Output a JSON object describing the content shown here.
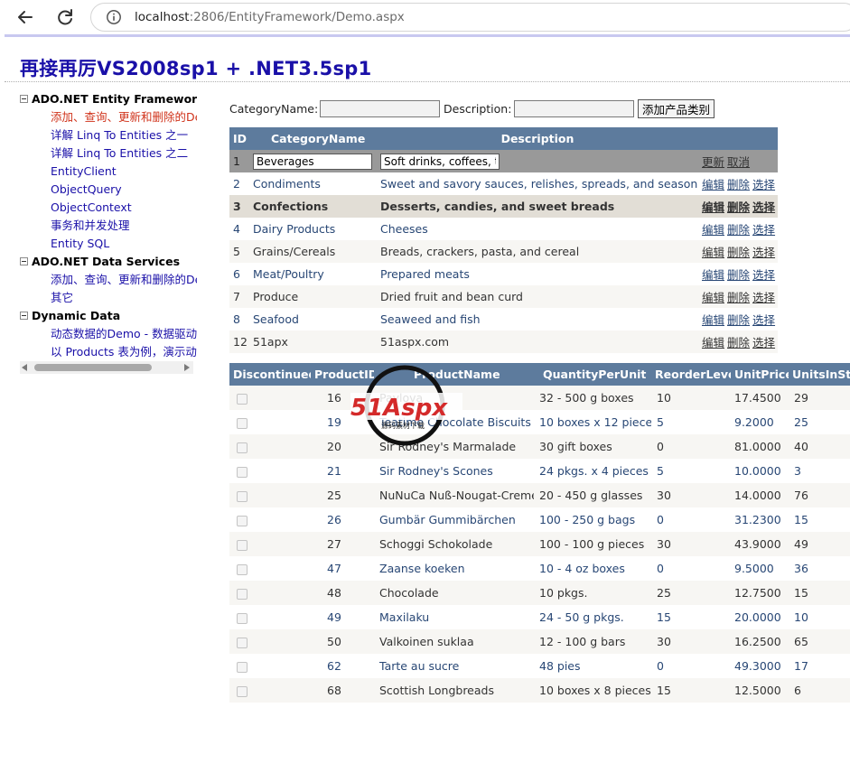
{
  "browser": {
    "url_host": "localhost",
    "url_rest": ":2806/EntityFramework/Demo.aspx"
  },
  "page": {
    "title": "再接再厉VS2008sp1 + .NET3.5sp1"
  },
  "tree": {
    "groups": [
      {
        "label": "ADO.NET Entity Framework",
        "items": [
          "添加、查询、更新和删除的De",
          "详解 Linq To Entities 之一",
          "详解 Linq To Entities 之二",
          "EntityClient",
          "ObjectQuery",
          "ObjectContext",
          "事务和并发处理",
          "Entity SQL"
        ]
      },
      {
        "label": "ADO.NET Data Services",
        "items": [
          "添加、查询、更新和删除的De",
          "其它"
        ]
      },
      {
        "label": "Dynamic Data",
        "items": [
          "动态数据的Demo - 数据驱动的",
          "以 Products 表为例，演示动态"
        ]
      }
    ]
  },
  "form": {
    "category_label": "CategoryName:",
    "category_value": "",
    "description_label": "Description:",
    "description_value": "",
    "add_button": "添加产品类别"
  },
  "categories": {
    "headers": [
      "ID",
      "CategoryName",
      "Description"
    ],
    "edit_row": {
      "id": "1",
      "name": "Beverages",
      "description": "Soft drinks, coffees, tea",
      "update": "更新",
      "cancel": "取消"
    },
    "action_labels": {
      "edit": "编辑",
      "delete": "删除",
      "select": "选择"
    },
    "rows": [
      {
        "id": "2",
        "name": "Condiments",
        "description": "Sweet and savory sauces, relishes, spreads, and seasonings"
      },
      {
        "id": "3",
        "name": "Confections",
        "description": "Desserts, candies, and sweet breads"
      },
      {
        "id": "4",
        "name": "Dairy Products",
        "description": "Cheeses"
      },
      {
        "id": "5",
        "name": "Grains/Cereals",
        "description": "Breads, crackers, pasta, and cereal"
      },
      {
        "id": "6",
        "name": "Meat/Poultry",
        "description": "Prepared meats"
      },
      {
        "id": "7",
        "name": "Produce",
        "description": "Dried fruit and bean curd"
      },
      {
        "id": "8",
        "name": "Seafood",
        "description": "Seaweed and fish"
      },
      {
        "id": "12",
        "name": "51apx",
        "description": "51aspx.com"
      }
    ],
    "selected_id": "3"
  },
  "products": {
    "headers": [
      "Discontinued",
      "ProductID",
      "ProductName",
      "QuantityPerUnit",
      "ReorderLevel",
      "UnitPrice",
      "UnitsInStock"
    ],
    "rows": [
      {
        "id": "16",
        "name": "Pavlova",
        "qty": "32 - 500 g boxes",
        "reorder": "10",
        "price": "17.4500",
        "stock": "29"
      },
      {
        "id": "19",
        "name": "Teatime Chocolate Biscuits",
        "qty": "10 boxes x 12 pieces",
        "reorder": "5",
        "price": "9.2000",
        "stock": "25"
      },
      {
        "id": "20",
        "name": "Sir Rodney's Marmalade",
        "qty": "30 gift boxes",
        "reorder": "0",
        "price": "81.0000",
        "stock": "40"
      },
      {
        "id": "21",
        "name": "Sir Rodney's Scones",
        "qty": "24 pkgs. x 4 pieces",
        "reorder": "5",
        "price": "10.0000",
        "stock": "3"
      },
      {
        "id": "25",
        "name": "NuNuCa Nuß-Nougat-Creme",
        "qty": "20 - 450 g glasses",
        "reorder": "30",
        "price": "14.0000",
        "stock": "76"
      },
      {
        "id": "26",
        "name": "Gumbär Gummibärchen",
        "qty": "100 - 250 g bags",
        "reorder": "0",
        "price": "31.2300",
        "stock": "15"
      },
      {
        "id": "27",
        "name": "Schoggi Schokolade",
        "qty": "100 - 100 g pieces",
        "reorder": "30",
        "price": "43.9000",
        "stock": "49"
      },
      {
        "id": "47",
        "name": "Zaanse koeken",
        "qty": "10 - 4 oz boxes",
        "reorder": "0",
        "price": "9.5000",
        "stock": "36"
      },
      {
        "id": "48",
        "name": "Chocolade",
        "qty": "10 pkgs.",
        "reorder": "25",
        "price": "12.7500",
        "stock": "15"
      },
      {
        "id": "49",
        "name": "Maxilaku",
        "qty": "24 - 50 g pkgs.",
        "reorder": "15",
        "price": "20.0000",
        "stock": "10"
      },
      {
        "id": "50",
        "name": "Valkoinen suklaa",
        "qty": "12 - 100 g bars",
        "reorder": "30",
        "price": "16.2500",
        "stock": "65"
      },
      {
        "id": "62",
        "name": "Tarte au sucre",
        "qty": "48 pies",
        "reorder": "0",
        "price": "49.3000",
        "stock": "17"
      },
      {
        "id": "68",
        "name": "Scottish Longbreads",
        "qty": "10 boxes x 8 pieces",
        "reorder": "15",
        "price": "12.5000",
        "stock": "6"
      }
    ]
  },
  "watermark": {
    "logo_text": "51Aspx",
    "sub_text": "源码素材下载"
  },
  "colors": {
    "header_bg": "#5d7b9d",
    "row_odd": "#f7f6f3",
    "row_selected": "#e2ded6",
    "row_edit": "#999999",
    "link_blue": "#1a10a8",
    "active_red": "#d0341c"
  }
}
